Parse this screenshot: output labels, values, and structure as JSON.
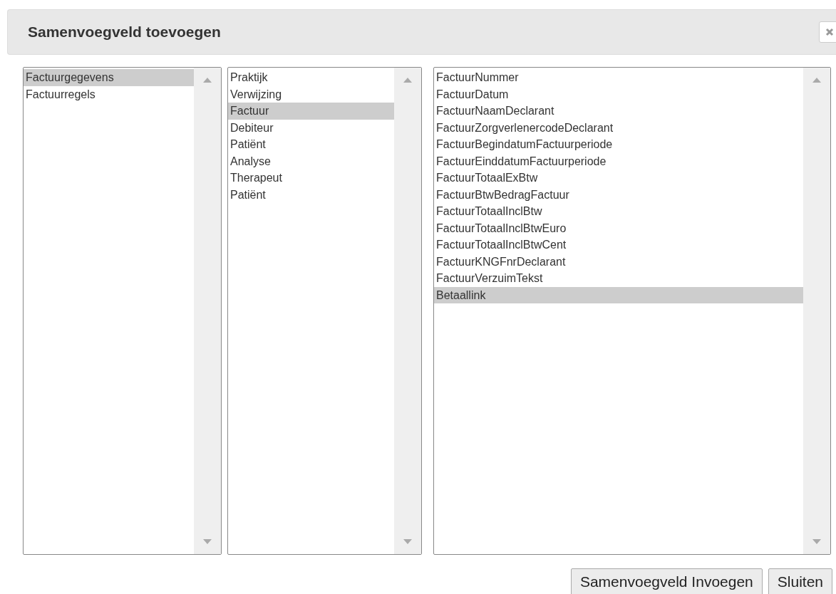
{
  "dialog": {
    "title": "Samenvoegveld toevoegen"
  },
  "lists": [
    {
      "items": [
        {
          "label": "Factuurgegevens",
          "selected": true
        },
        {
          "label": "Factuurregels",
          "selected": false
        }
      ]
    },
    {
      "items": [
        {
          "label": "Praktijk",
          "selected": false
        },
        {
          "label": "Verwijzing",
          "selected": false
        },
        {
          "label": "Factuur",
          "selected": true
        },
        {
          "label": "Debiteur",
          "selected": false
        },
        {
          "label": "Patiënt",
          "selected": false
        },
        {
          "label": "Analyse",
          "selected": false
        },
        {
          "label": "Therapeut",
          "selected": false
        },
        {
          "label": "Patiënt",
          "selected": false
        }
      ]
    },
    {
      "items": [
        {
          "label": "FactuurNummer",
          "selected": false
        },
        {
          "label": "FactuurDatum",
          "selected": false
        },
        {
          "label": "FactuurNaamDeclarant",
          "selected": false
        },
        {
          "label": "FactuurZorgverlenercodeDeclarant",
          "selected": false
        },
        {
          "label": "FactuurBegindatumFactuurperiode",
          "selected": false
        },
        {
          "label": "FactuurEinddatumFactuurperiode",
          "selected": false
        },
        {
          "label": "FactuurTotaalExBtw",
          "selected": false
        },
        {
          "label": "FactuurBtwBedragFactuur",
          "selected": false
        },
        {
          "label": "FactuurTotaalInclBtw",
          "selected": false
        },
        {
          "label": "FactuurTotaalInclBtwEuro",
          "selected": false
        },
        {
          "label": "FactuurTotaalInclBtwCent",
          "selected": false
        },
        {
          "label": "FactuurKNGFnrDeclarant",
          "selected": false
        },
        {
          "label": "FactuurVerzuimTekst",
          "selected": false
        },
        {
          "label": "Betaallink",
          "selected": true
        }
      ]
    }
  ],
  "buttons": [
    "Samenvoegveld Invoegen",
    "Sluiten"
  ]
}
